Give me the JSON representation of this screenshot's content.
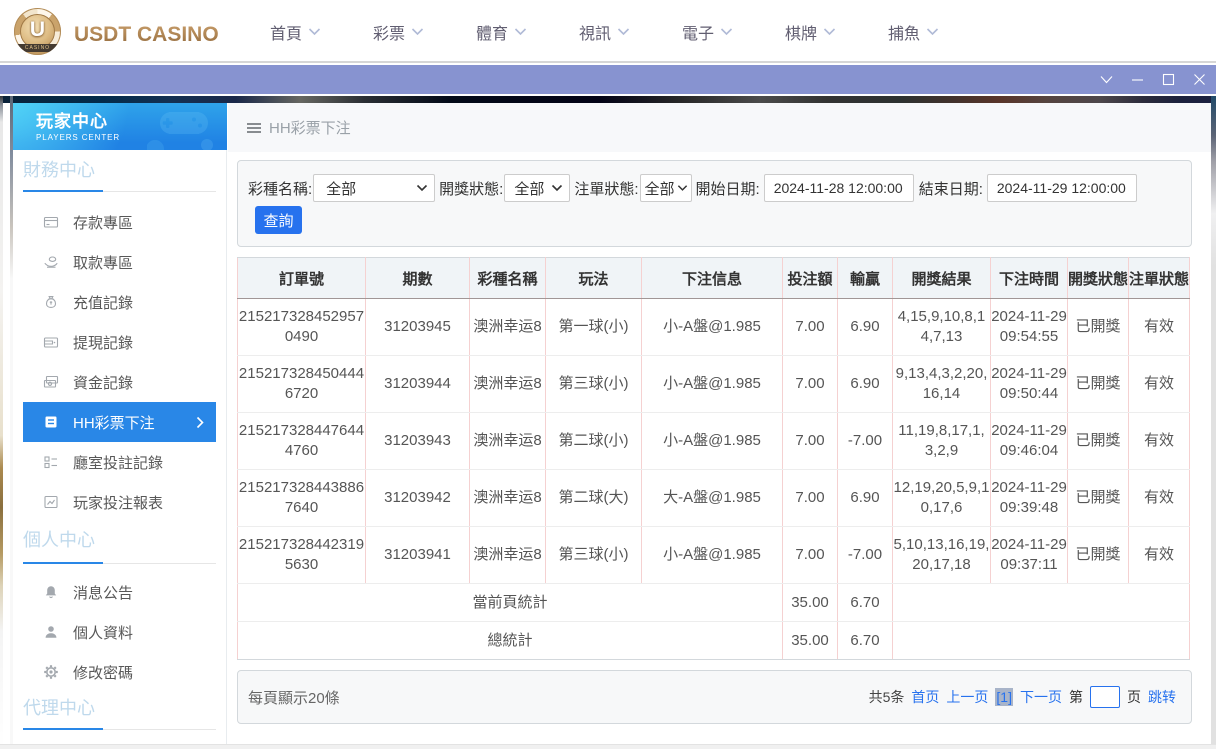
{
  "header": {
    "logo_text": "USDT CASINO",
    "logo_u": "U",
    "logo_band": "CASINO",
    "nav": [
      {
        "label": "首頁"
      },
      {
        "label": "彩票"
      },
      {
        "label": "體育"
      },
      {
        "label": "視訊"
      },
      {
        "label": "電子"
      },
      {
        "label": "棋牌"
      },
      {
        "label": "捕魚"
      }
    ]
  },
  "sidebar": {
    "title": "玩家中心",
    "subtitle": "PLAYERS CENTER",
    "sections": [
      {
        "title": "財務中心",
        "items": [
          {
            "icon": "bank-card",
            "label": "存款專區"
          },
          {
            "icon": "withdraw-hand",
            "label": "取款專區"
          },
          {
            "icon": "money-bag",
            "label": "充值記錄"
          },
          {
            "icon": "wallet",
            "label": "提現記錄"
          },
          {
            "icon": "banknotes",
            "label": "資金記錄"
          },
          {
            "icon": "lottery-doc",
            "label": "HH彩票下注",
            "active": true
          },
          {
            "icon": "hall-list",
            "label": "廳室投註記錄"
          },
          {
            "icon": "report-chart",
            "label": "玩家投注報表"
          }
        ]
      },
      {
        "title": "個人中心",
        "items": [
          {
            "icon": "bell",
            "label": "消息公告"
          },
          {
            "icon": "person",
            "label": "個人資料"
          },
          {
            "icon": "gear",
            "label": "修改密碼"
          }
        ]
      },
      {
        "title": "代理中心",
        "items": []
      }
    ]
  },
  "breadcrumb": {
    "title": "HH彩票下注"
  },
  "filters": {
    "lottery_label": "彩種名稱:",
    "lottery_value": "全部",
    "draw_label": "開獎狀態:",
    "draw_value": "全部",
    "order_label": "注單狀態:",
    "order_value": "全部",
    "start_label": "開始日期:",
    "start_value": "2024-11-28 12:00:00",
    "end_label": "結束日期:",
    "end_value": "2024-11-29 12:00:00",
    "query_label": "查詢"
  },
  "table": {
    "columns": [
      "訂單號",
      "期數",
      "彩種名稱",
      "玩法",
      "下注信息",
      "投注額",
      "輸贏",
      "開獎結果",
      "下注時間",
      "開獎狀態",
      "注單狀態"
    ],
    "column_keys": [
      "order-no",
      "period",
      "lottery-name",
      "play",
      "bet-info",
      "bet-amount",
      "win-loss",
      "draw-result",
      "bet-time",
      "draw-status",
      "order-status"
    ],
    "rows": [
      [
        "2152173284529570490",
        "31203945",
        "澳洲幸运8",
        "第一球(小)",
        "小-A盤@1.985",
        "7.00",
        "6.90",
        "4,15,9,10,8,14,7,13",
        "2024-11-29 09:54:55",
        "已開獎",
        "有效"
      ],
      [
        "2152173284504446720",
        "31203944",
        "澳洲幸运8",
        "第三球(小)",
        "小-A盤@1.985",
        "7.00",
        "6.90",
        "9,13,4,3,2,20,16,14",
        "2024-11-29 09:50:44",
        "已開獎",
        "有效"
      ],
      [
        "2152173284476444760",
        "31203943",
        "澳洲幸运8",
        "第二球(小)",
        "小-A盤@1.985",
        "7.00",
        "-7.00",
        "11,19,8,17,1,3,2,9",
        "2024-11-29 09:46:04",
        "已開獎",
        "有效"
      ],
      [
        "2152173284438867640",
        "31203942",
        "澳洲幸运8",
        "第二球(大)",
        "大-A盤@1.985",
        "7.00",
        "6.90",
        "12,19,20,5,9,10,17,6",
        "2024-11-29 09:39:48",
        "已開獎",
        "有效"
      ],
      [
        "2152173284423195630",
        "31203941",
        "澳洲幸运8",
        "第三球(小)",
        "小-A盤@1.985",
        "7.00",
        "-7.00",
        "5,10,13,16,19,20,17,18",
        "2024-11-29 09:37:11",
        "已開獎",
        "有效"
      ]
    ],
    "summaries": [
      {
        "label": "當前頁統計",
        "bet_amount": "35.00",
        "win_loss": "6.70"
      },
      {
        "label": "總統計",
        "bet_amount": "35.00",
        "win_loss": "6.70"
      }
    ]
  },
  "pagination": {
    "per_page": "每頁顯示20條",
    "total": "共5条",
    "first": "首页",
    "prev": "上一页",
    "current": "[1]",
    "next": "下一页",
    "jump_pre": "第",
    "jump_suf": "页",
    "jump": "跳转",
    "jump_value": ""
  }
}
